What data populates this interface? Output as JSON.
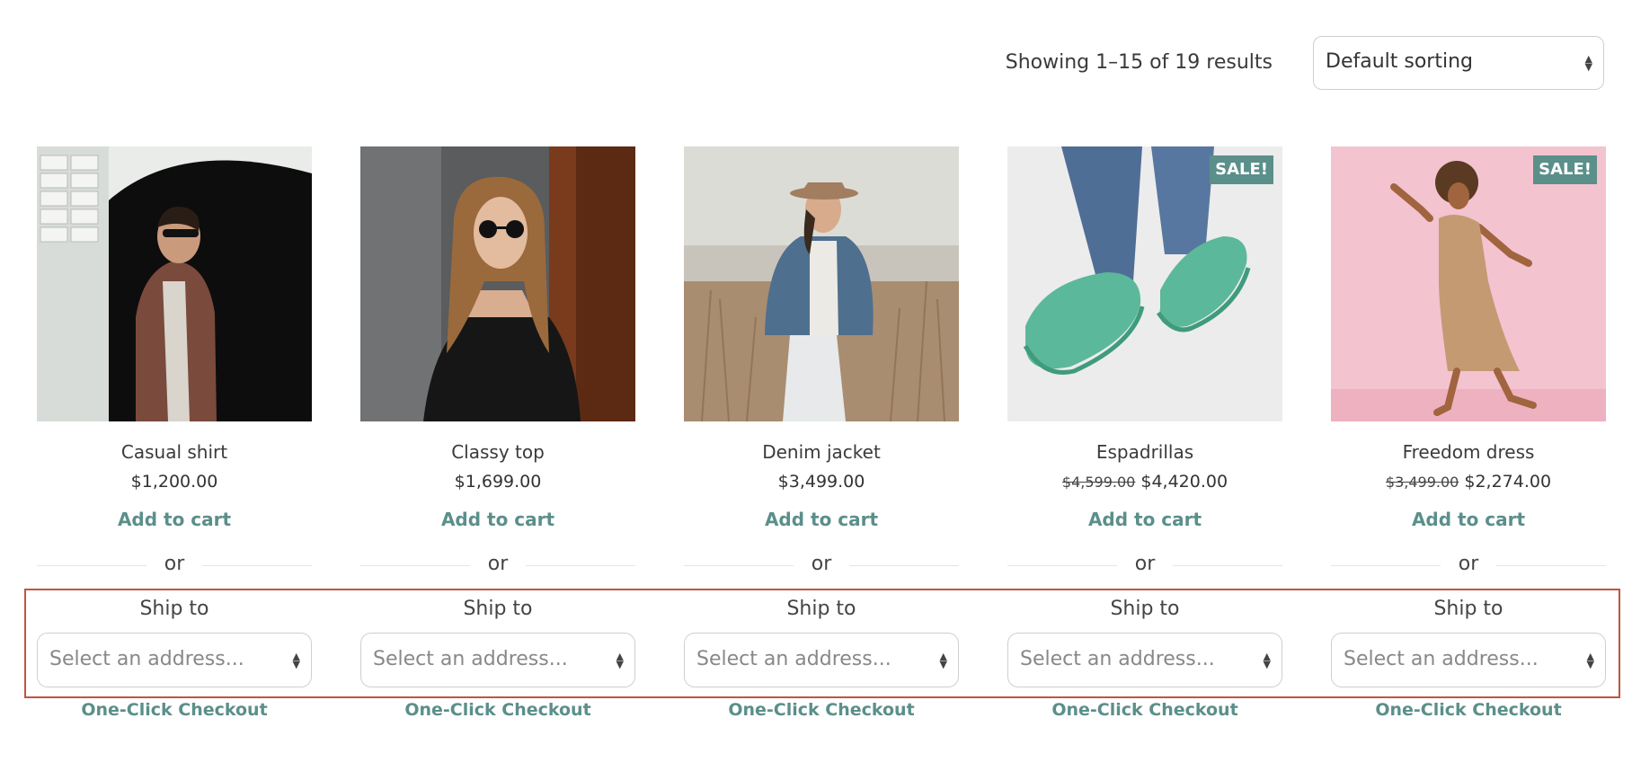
{
  "toolbar": {
    "result_count": "Showing 1–15 of 19 results",
    "sorting_selected": "Default sorting"
  },
  "products": [
    {
      "title": "Casual shirt",
      "price": "$1,200.00",
      "old_price": null,
      "sale": false,
      "add_to_cart": "Add to cart",
      "or": "or",
      "ship_to": "Ship to",
      "address_placeholder": "Select an address...",
      "checkout": "One-Click Checkout"
    },
    {
      "title": "Classy top",
      "price": "$1,699.00",
      "old_price": null,
      "sale": false,
      "add_to_cart": "Add to cart",
      "or": "or",
      "ship_to": "Ship to",
      "address_placeholder": "Select an address...",
      "checkout": "One-Click Checkout"
    },
    {
      "title": "Denim jacket",
      "price": "$3,499.00",
      "old_price": null,
      "sale": false,
      "add_to_cart": "Add to cart",
      "or": "or",
      "ship_to": "Ship to",
      "address_placeholder": "Select an address...",
      "checkout": "One-Click Checkout"
    },
    {
      "title": "Espadrillas",
      "price": "$4,420.00",
      "old_price": "$4,599.00",
      "sale": true,
      "sale_label": "SALE!",
      "add_to_cart": "Add to cart",
      "or": "or",
      "ship_to": "Ship to",
      "address_placeholder": "Select an address...",
      "checkout": "One-Click Checkout"
    },
    {
      "title": "Freedom dress",
      "price": "$2,274.00",
      "old_price": "$3,499.00",
      "sale": true,
      "sale_label": "SALE!",
      "add_to_cart": "Add to cart",
      "or": "or",
      "ship_to": "Ship to",
      "address_placeholder": "Select an address...",
      "checkout": "One-Click Checkout"
    }
  ],
  "colors": {
    "accent": "#5b8f8a",
    "highlight": "#c0553f"
  }
}
